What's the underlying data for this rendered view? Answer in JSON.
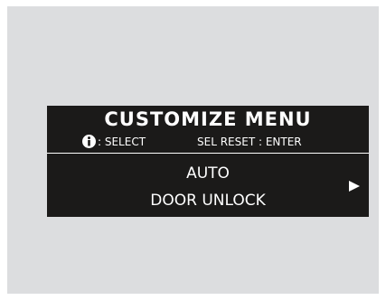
{
  "display": {
    "title": "CUSTOMIZE MENU",
    "hint_select": ": SELECT",
    "hint_enter": "SEL RESET : ENTER",
    "info_icon": "info-icon",
    "option_line1": "AUTO",
    "option_line2": "DOOR UNLOCK",
    "next_icon": "right-arrow-icon"
  }
}
